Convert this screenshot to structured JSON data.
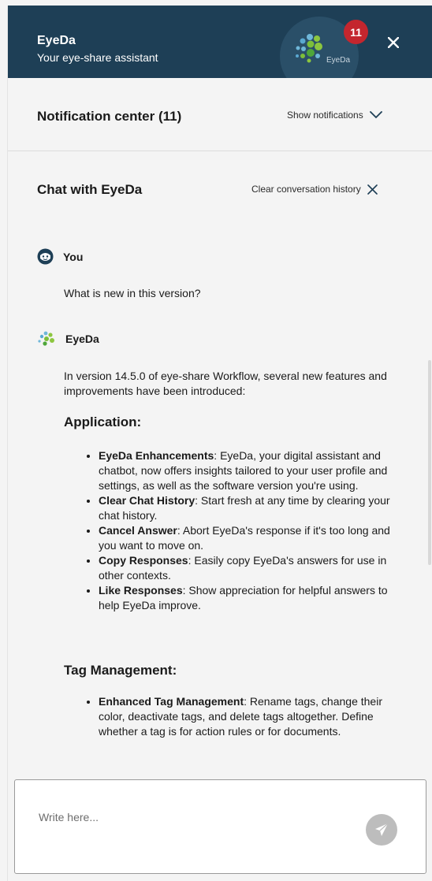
{
  "header": {
    "title": "EyeDa",
    "subtitle": "Your eye-share assistant",
    "avatar_label": "EyeDa",
    "badge_count": "11",
    "bg_color": "#1e3f56",
    "badge_color": "#c4262e",
    "close_icon": "close-icon"
  },
  "notifications": {
    "title": "Notification center (11)",
    "action_label": "Show notifications",
    "action_icon": "chevron-down-icon"
  },
  "chat": {
    "title": "Chat with EyeDa",
    "clear_label": "Clear conversation history",
    "clear_icon": "close-icon"
  },
  "messages": {
    "user": {
      "author": "You",
      "icon": "user-face-icon",
      "text": "What is new in this version?"
    },
    "bot": {
      "author": "EyeDa",
      "icon": "eyeda-logo-icon",
      "intro": "In version 14.5.0 of eye-share Workflow, several new features and improvements have been introduced:",
      "section1_title": "Application:",
      "section1_items": [
        {
          "title": "EyeDa Enhancements",
          "text": ": EyeDa, your digital assistant and chatbot, now offers insights tailored to your user profile and settings, as well as the software version you're using."
        },
        {
          "title": "Clear Chat History",
          "text": ": Start fresh at any time by clearing your chat history."
        },
        {
          "title": "Cancel Answer",
          "text": ": Abort EyeDa's response if it's too long and you want to move on."
        },
        {
          "title": "Copy Responses",
          "text": ": Easily copy EyeDa's answers for use in other contexts."
        },
        {
          "title": "Like Responses",
          "text": ": Show appreciation for helpful answers to help EyeDa improve."
        }
      ],
      "section2_title": "Tag Management:",
      "section2_items": [
        {
          "title": "Enhanced Tag Management",
          "text": ": Rename tags, change their color, deactivate tags, and delete tags altogether. Define whether a tag is for action rules or for documents."
        }
      ]
    }
  },
  "input": {
    "placeholder": "Write here...",
    "send_icon": "send-icon"
  }
}
